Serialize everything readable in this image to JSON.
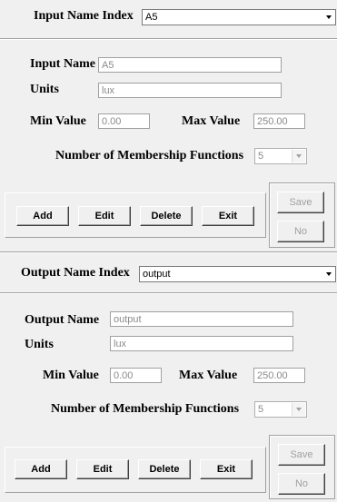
{
  "input_panel": {
    "index_label": "Input Name Index",
    "index_value": "A5",
    "name_label": "Input Name",
    "name_value": "A5",
    "units_label": "Units",
    "units_value": "lux",
    "min_label": "Min Value",
    "min_value": "0.00",
    "max_label": "Max Value",
    "max_value": "250.00",
    "mf_label": "Number of  Membership Functions",
    "mf_value": "5",
    "buttons": {
      "add": "Add",
      "edit": "Edit",
      "delete": "Delete",
      "exit": "Exit"
    },
    "save_label": "Save",
    "no_label": "No"
  },
  "output_panel": {
    "index_label": "Output Name Index",
    "index_value": "output",
    "name_label": "Output Name",
    "name_value": "output",
    "units_label": "Units",
    "units_value": "lux",
    "min_label": "Min Value",
    "min_value": "0.00",
    "max_label": "Max Value",
    "max_value": "250.00",
    "mf_label": "Number of  Membership Functions",
    "mf_value": "5",
    "buttons": {
      "add": "Add",
      "edit": "Edit",
      "delete": "Delete",
      "exit": "Exit"
    },
    "save_label": "Save",
    "no_label": "No"
  }
}
